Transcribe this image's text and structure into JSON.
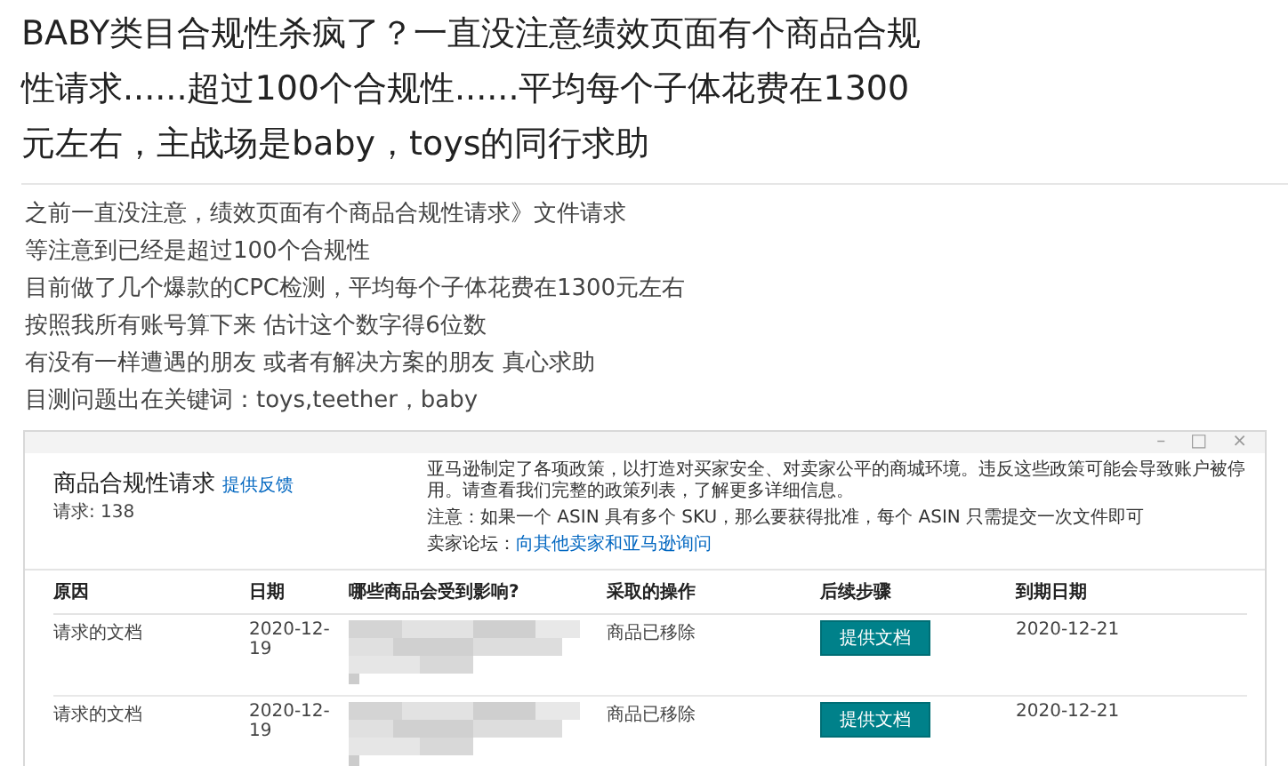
{
  "post": {
    "title": "BABY类目合规性杀疯了？一直没注意绩效页面有个商品合规性请求......超过100个合规性......平均每个子体花费在1300元左右，主战场是baby，toys的同行求助",
    "body": [
      "之前一直没注意，绩效页面有个商品合规性请求》文件请求",
      "等注意到已经是超过100个合规性",
      "目前做了几个爆款的CPC检测，平均每个子体花费在1300元左右",
      "按照我所有账号算下来 估计这个数字得6位数",
      "有没有一样遭遇的朋友 或者有解决方案的朋友 真心求助",
      "目测问题出在关键词：toys,teether，baby"
    ]
  },
  "screenshot": {
    "window_controls": [
      "–",
      "□",
      "×"
    ],
    "title": "商品合规性请求",
    "feedback_link": "提供反馈",
    "count": "请求: 138",
    "notice": [
      {
        "kind": "text",
        "text": "亚马逊制定了各项政策，以打造对买家安全、对卖家公平的商城环境。违反这些政策可能会导致账户被停用。请查看我们完整的政策列表，了解更多详细信息。"
      },
      {
        "kind": "text",
        "text": "注意：如果一个 ASIN 具有多个 SKU，那么要获得批准，每个 ASIN 只需提交一次文件即可"
      },
      {
        "kind": "forum",
        "label": "卖家论坛：",
        "link": "向其他卖家和亚马逊询问"
      }
    ],
    "columns": [
      "原因",
      "日期",
      "哪些商品会受到影响?",
      "采取的操作",
      "后续步骤",
      "到期日期"
    ],
    "rows": [
      {
        "reason": "请求的文档",
        "date": "2020-12-19",
        "action": "商品已移除",
        "button": "提供文档",
        "due": "2020-12-21"
      },
      {
        "reason": "请求的文档",
        "date": "2020-12-19",
        "action": "商品已移除",
        "button": "提供文档",
        "due": "2020-12-21"
      }
    ]
  }
}
